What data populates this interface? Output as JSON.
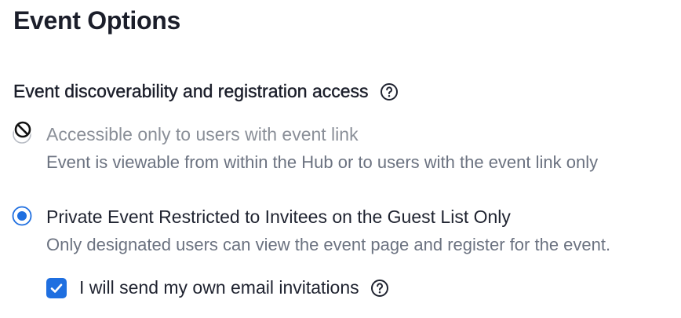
{
  "page": {
    "title": "Event Options"
  },
  "section": {
    "label": "Event discoverability and registration access",
    "help_icon": "question-circle-icon"
  },
  "options": [
    {
      "label": "Accessible only to users with event link",
      "description": "Event is viewable from within the Hub or to users with the event link only",
      "state": "disabled",
      "icon": "not-allowed-cursor-icon"
    },
    {
      "label": "Private Event Restricted to Invitees on the Guest List Only",
      "description": "Only designated users can view the event page and register for the event.",
      "state": "selected"
    }
  ],
  "send_invites": {
    "label": "I will send my own email invitations",
    "checked": true,
    "help_icon": "question-circle-icon"
  },
  "colors": {
    "accent": "#1f6fe0",
    "text": "#1f2330",
    "muted": "#6b7280",
    "disabled": "#8a8f98"
  }
}
